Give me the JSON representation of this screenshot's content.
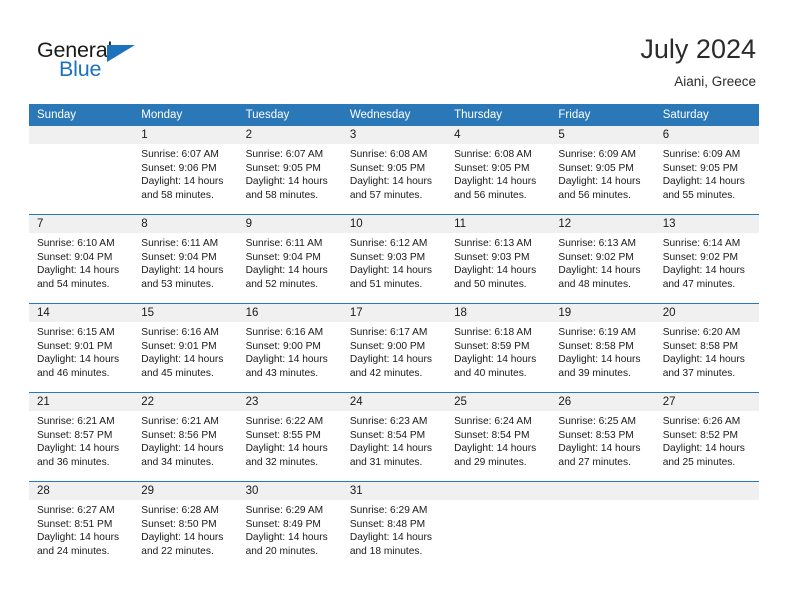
{
  "brand": {
    "name_part1": "General",
    "name_part2": "Blue",
    "logo_icon": "triangle-flag-icon"
  },
  "header": {
    "title": "July 2024",
    "subtitle": "Aiani, Greece"
  },
  "colors": {
    "header_blue": "#2b78b9",
    "band_gray": "#f0f0f0",
    "brand_blue": "#1c72bd",
    "text": "#1a1a1a"
  },
  "weekdays": [
    "Sunday",
    "Monday",
    "Tuesday",
    "Wednesday",
    "Thursday",
    "Friday",
    "Saturday"
  ],
  "weeks": [
    [
      {
        "day": "",
        "sunrise": "",
        "sunset": "",
        "daylight_line1": "",
        "daylight_line2": ""
      },
      {
        "day": "1",
        "sunrise": "Sunrise: 6:07 AM",
        "sunset": "Sunset: 9:06 PM",
        "daylight_line1": "Daylight: 14 hours",
        "daylight_line2": "and 58 minutes."
      },
      {
        "day": "2",
        "sunrise": "Sunrise: 6:07 AM",
        "sunset": "Sunset: 9:05 PM",
        "daylight_line1": "Daylight: 14 hours",
        "daylight_line2": "and 58 minutes."
      },
      {
        "day": "3",
        "sunrise": "Sunrise: 6:08 AM",
        "sunset": "Sunset: 9:05 PM",
        "daylight_line1": "Daylight: 14 hours",
        "daylight_line2": "and 57 minutes."
      },
      {
        "day": "4",
        "sunrise": "Sunrise: 6:08 AM",
        "sunset": "Sunset: 9:05 PM",
        "daylight_line1": "Daylight: 14 hours",
        "daylight_line2": "and 56 minutes."
      },
      {
        "day": "5",
        "sunrise": "Sunrise: 6:09 AM",
        "sunset": "Sunset: 9:05 PM",
        "daylight_line1": "Daylight: 14 hours",
        "daylight_line2": "and 56 minutes."
      },
      {
        "day": "6",
        "sunrise": "Sunrise: 6:09 AM",
        "sunset": "Sunset: 9:05 PM",
        "daylight_line1": "Daylight: 14 hours",
        "daylight_line2": "and 55 minutes."
      }
    ],
    [
      {
        "day": "7",
        "sunrise": "Sunrise: 6:10 AM",
        "sunset": "Sunset: 9:04 PM",
        "daylight_line1": "Daylight: 14 hours",
        "daylight_line2": "and 54 minutes."
      },
      {
        "day": "8",
        "sunrise": "Sunrise: 6:11 AM",
        "sunset": "Sunset: 9:04 PM",
        "daylight_line1": "Daylight: 14 hours",
        "daylight_line2": "and 53 minutes."
      },
      {
        "day": "9",
        "sunrise": "Sunrise: 6:11 AM",
        "sunset": "Sunset: 9:04 PM",
        "daylight_line1": "Daylight: 14 hours",
        "daylight_line2": "and 52 minutes."
      },
      {
        "day": "10",
        "sunrise": "Sunrise: 6:12 AM",
        "sunset": "Sunset: 9:03 PM",
        "daylight_line1": "Daylight: 14 hours",
        "daylight_line2": "and 51 minutes."
      },
      {
        "day": "11",
        "sunrise": "Sunrise: 6:13 AM",
        "sunset": "Sunset: 9:03 PM",
        "daylight_line1": "Daylight: 14 hours",
        "daylight_line2": "and 50 minutes."
      },
      {
        "day": "12",
        "sunrise": "Sunrise: 6:13 AM",
        "sunset": "Sunset: 9:02 PM",
        "daylight_line1": "Daylight: 14 hours",
        "daylight_line2": "and 48 minutes."
      },
      {
        "day": "13",
        "sunrise": "Sunrise: 6:14 AM",
        "sunset": "Sunset: 9:02 PM",
        "daylight_line1": "Daylight: 14 hours",
        "daylight_line2": "and 47 minutes."
      }
    ],
    [
      {
        "day": "14",
        "sunrise": "Sunrise: 6:15 AM",
        "sunset": "Sunset: 9:01 PM",
        "daylight_line1": "Daylight: 14 hours",
        "daylight_line2": "and 46 minutes."
      },
      {
        "day": "15",
        "sunrise": "Sunrise: 6:16 AM",
        "sunset": "Sunset: 9:01 PM",
        "daylight_line1": "Daylight: 14 hours",
        "daylight_line2": "and 45 minutes."
      },
      {
        "day": "16",
        "sunrise": "Sunrise: 6:16 AM",
        "sunset": "Sunset: 9:00 PM",
        "daylight_line1": "Daylight: 14 hours",
        "daylight_line2": "and 43 minutes."
      },
      {
        "day": "17",
        "sunrise": "Sunrise: 6:17 AM",
        "sunset": "Sunset: 9:00 PM",
        "daylight_line1": "Daylight: 14 hours",
        "daylight_line2": "and 42 minutes."
      },
      {
        "day": "18",
        "sunrise": "Sunrise: 6:18 AM",
        "sunset": "Sunset: 8:59 PM",
        "daylight_line1": "Daylight: 14 hours",
        "daylight_line2": "and 40 minutes."
      },
      {
        "day": "19",
        "sunrise": "Sunrise: 6:19 AM",
        "sunset": "Sunset: 8:58 PM",
        "daylight_line1": "Daylight: 14 hours",
        "daylight_line2": "and 39 minutes."
      },
      {
        "day": "20",
        "sunrise": "Sunrise: 6:20 AM",
        "sunset": "Sunset: 8:58 PM",
        "daylight_line1": "Daylight: 14 hours",
        "daylight_line2": "and 37 minutes."
      }
    ],
    [
      {
        "day": "21",
        "sunrise": "Sunrise: 6:21 AM",
        "sunset": "Sunset: 8:57 PM",
        "daylight_line1": "Daylight: 14 hours",
        "daylight_line2": "and 36 minutes."
      },
      {
        "day": "22",
        "sunrise": "Sunrise: 6:21 AM",
        "sunset": "Sunset: 8:56 PM",
        "daylight_line1": "Daylight: 14 hours",
        "daylight_line2": "and 34 minutes."
      },
      {
        "day": "23",
        "sunrise": "Sunrise: 6:22 AM",
        "sunset": "Sunset: 8:55 PM",
        "daylight_line1": "Daylight: 14 hours",
        "daylight_line2": "and 32 minutes."
      },
      {
        "day": "24",
        "sunrise": "Sunrise: 6:23 AM",
        "sunset": "Sunset: 8:54 PM",
        "daylight_line1": "Daylight: 14 hours",
        "daylight_line2": "and 31 minutes."
      },
      {
        "day": "25",
        "sunrise": "Sunrise: 6:24 AM",
        "sunset": "Sunset: 8:54 PM",
        "daylight_line1": "Daylight: 14 hours",
        "daylight_line2": "and 29 minutes."
      },
      {
        "day": "26",
        "sunrise": "Sunrise: 6:25 AM",
        "sunset": "Sunset: 8:53 PM",
        "daylight_line1": "Daylight: 14 hours",
        "daylight_line2": "and 27 minutes."
      },
      {
        "day": "27",
        "sunrise": "Sunrise: 6:26 AM",
        "sunset": "Sunset: 8:52 PM",
        "daylight_line1": "Daylight: 14 hours",
        "daylight_line2": "and 25 minutes."
      }
    ],
    [
      {
        "day": "28",
        "sunrise": "Sunrise: 6:27 AM",
        "sunset": "Sunset: 8:51 PM",
        "daylight_line1": "Daylight: 14 hours",
        "daylight_line2": "and 24 minutes."
      },
      {
        "day": "29",
        "sunrise": "Sunrise: 6:28 AM",
        "sunset": "Sunset: 8:50 PM",
        "daylight_line1": "Daylight: 14 hours",
        "daylight_line2": "and 22 minutes."
      },
      {
        "day": "30",
        "sunrise": "Sunrise: 6:29 AM",
        "sunset": "Sunset: 8:49 PM",
        "daylight_line1": "Daylight: 14 hours",
        "daylight_line2": "and 20 minutes."
      },
      {
        "day": "31",
        "sunrise": "Sunrise: 6:29 AM",
        "sunset": "Sunset: 8:48 PM",
        "daylight_line1": "Daylight: 14 hours",
        "daylight_line2": "and 18 minutes."
      },
      {
        "day": "",
        "sunrise": "",
        "sunset": "",
        "daylight_line1": "",
        "daylight_line2": ""
      },
      {
        "day": "",
        "sunrise": "",
        "sunset": "",
        "daylight_line1": "",
        "daylight_line2": ""
      },
      {
        "day": "",
        "sunrise": "",
        "sunset": "",
        "daylight_line1": "",
        "daylight_line2": ""
      }
    ]
  ]
}
